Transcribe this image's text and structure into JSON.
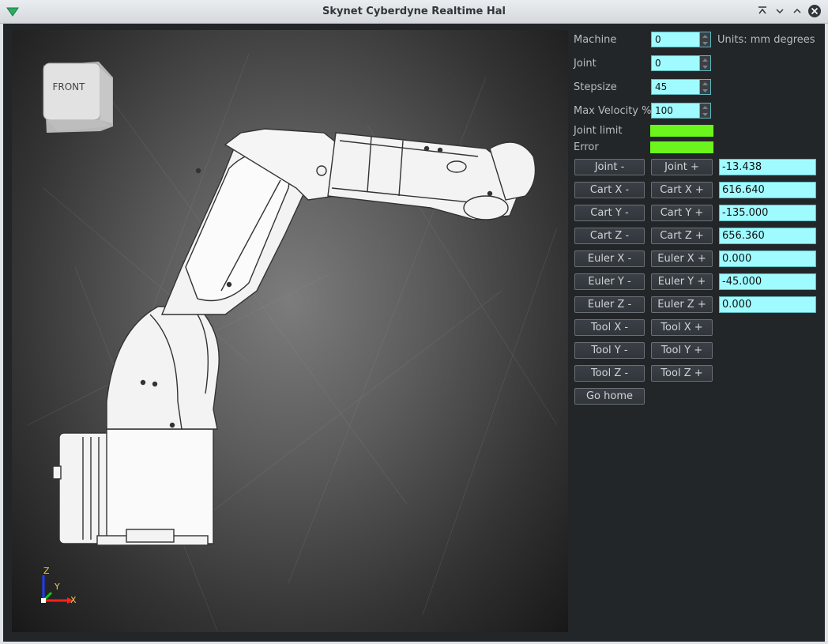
{
  "window": {
    "title": "Skynet Cyberdyne Realtime Hal"
  },
  "viewport": {
    "view_cube_label": "FRONT",
    "axes": {
      "x": "X",
      "y": "Y",
      "z": "Z"
    }
  },
  "controls": {
    "machine_label": "Machine",
    "machine_value": "0",
    "units_text": "Units: mm degrees",
    "joint_label": "Joint",
    "joint_value": "0",
    "stepsize_label": "Stepsize",
    "stepsize_value": "45",
    "max_velocity_label": "Max Velocity %",
    "max_velocity_value": "100",
    "joint_limit_label": "Joint limit",
    "error_label": "Error",
    "indicator_color": "#6cf51c"
  },
  "jog_rows": [
    {
      "minus": "Joint -",
      "plus": "Joint +",
      "value": "-13.438"
    },
    {
      "minus": "Cart X -",
      "plus": "Cart X +",
      "value": "616.640"
    },
    {
      "minus": "Cart Y -",
      "plus": "Cart Y +",
      "value": "-135.000"
    },
    {
      "minus": "Cart Z -",
      "plus": "Cart Z +",
      "value": "656.360"
    },
    {
      "minus": "Euler X -",
      "plus": "Euler X +",
      "value": "0.000"
    },
    {
      "minus": "Euler Y -",
      "plus": "Euler Y +",
      "value": "-45.000"
    },
    {
      "minus": "Euler Z -",
      "plus": "Euler Z +",
      "value": "0.000"
    },
    {
      "minus": "Tool X -",
      "plus": "Tool X +"
    },
    {
      "minus": "Tool Y -",
      "plus": "Tool Y +"
    },
    {
      "minus": "Tool Z -",
      "plus": "Tool Z +"
    }
  ],
  "go_home_label": "Go home",
  "colors": {
    "field_bg": "#9ffbff",
    "panel_bg": "#232629",
    "indicator": "#6cf51c"
  }
}
